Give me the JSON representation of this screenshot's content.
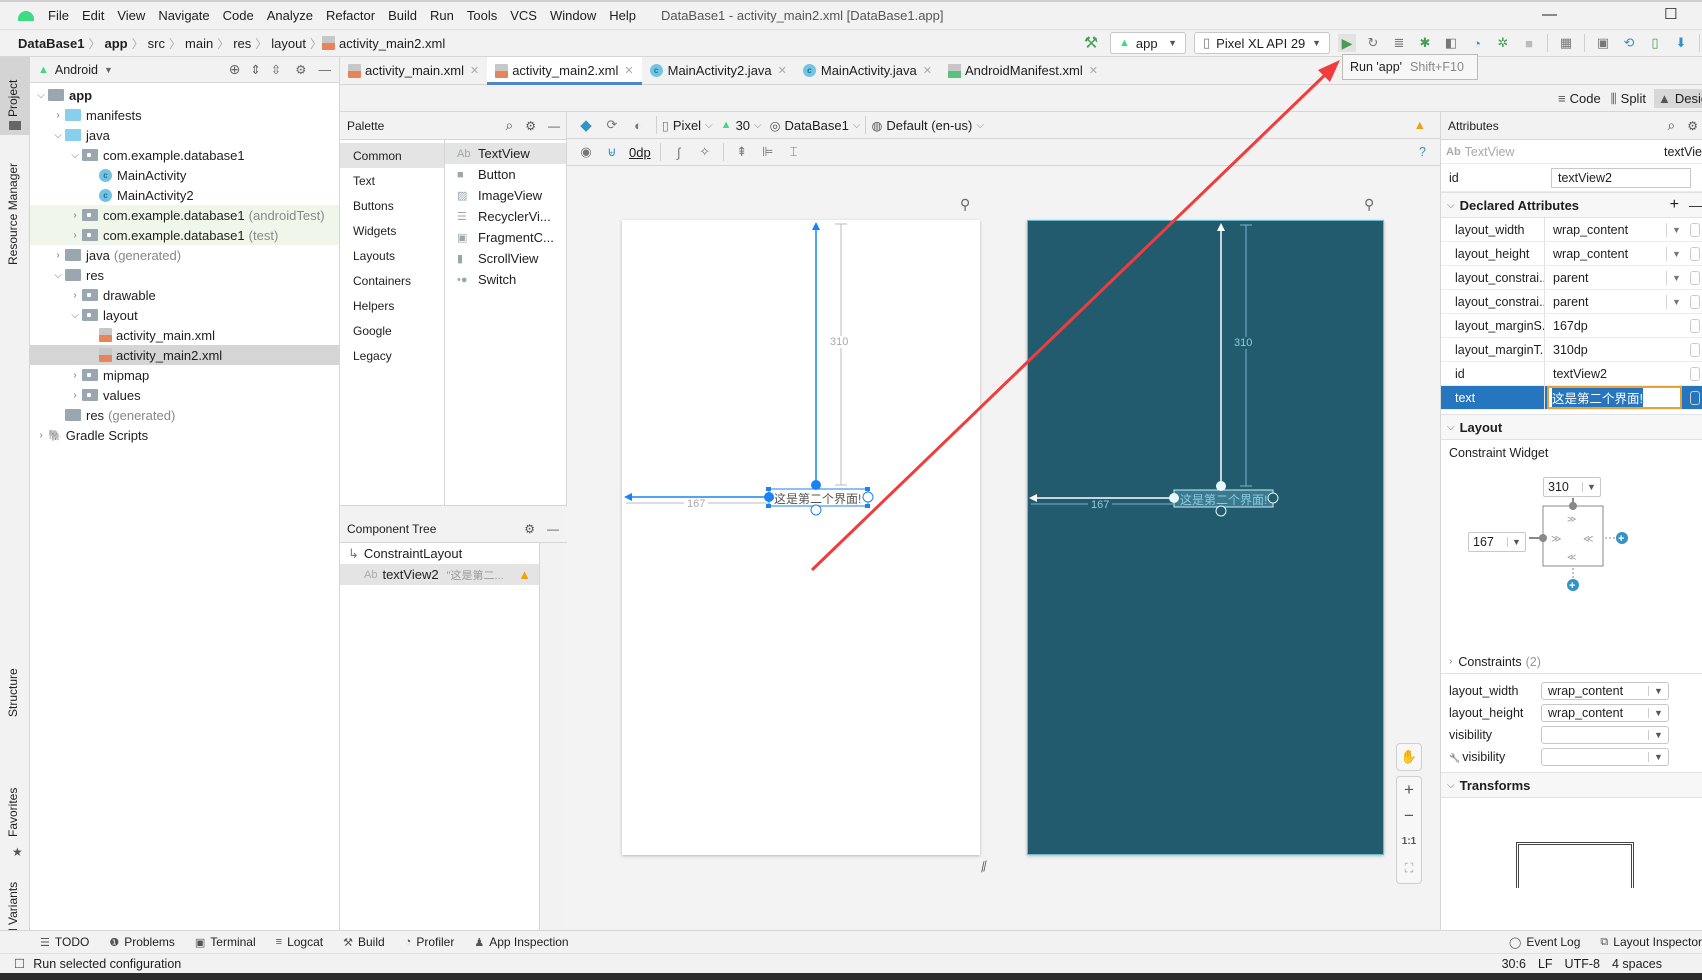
{
  "window": {
    "title": "DataBase1 - activity_main2.xml [DataBase1.app]",
    "menu": [
      "File",
      "Edit",
      "View",
      "Navigate",
      "Code",
      "Analyze",
      "Refactor",
      "Build",
      "Run",
      "Tools",
      "VCS",
      "Window",
      "Help"
    ]
  },
  "breadcrumb": [
    "DataBase1",
    "app",
    "src",
    "main",
    "res",
    "layout",
    "activity_main2.xml"
  ],
  "toolbar": {
    "run_config": "app",
    "device": "Pixel XL API 29",
    "tooltip_label": "Run 'app'",
    "tooltip_shortcut": "Shift+F10"
  },
  "left_strip": [
    "Project",
    "Resource Manager",
    "Structure",
    "Favorites",
    "Build Variants"
  ],
  "project": {
    "view_mode": "Android",
    "tree": [
      {
        "label": "app",
        "level": 0,
        "expanded": true,
        "bold": true
      },
      {
        "label": "manifests",
        "level": 1,
        "expanded": false
      },
      {
        "label": "java",
        "level": 1,
        "expanded": true
      },
      {
        "label": "com.example.database1",
        "level": 2,
        "expanded": true
      },
      {
        "label": "MainActivity",
        "level": 3,
        "type": "class"
      },
      {
        "label": "MainActivity2",
        "level": 3,
        "type": "class"
      },
      {
        "label": "com.example.database1",
        "suffix": "(androidTest)",
        "level": 2,
        "expanded": false
      },
      {
        "label": "com.example.database1",
        "suffix": "(test)",
        "level": 2,
        "expanded": false
      },
      {
        "label": "java",
        "suffix": "(generated)",
        "level": 1,
        "expanded": false
      },
      {
        "label": "res",
        "level": 1,
        "expanded": true
      },
      {
        "label": "drawable",
        "level": 2,
        "expanded": false
      },
      {
        "label": "layout",
        "level": 2,
        "expanded": true
      },
      {
        "label": "activity_main.xml",
        "level": 3,
        "type": "xml"
      },
      {
        "label": "activity_main2.xml",
        "level": 3,
        "type": "xml",
        "selected": true
      },
      {
        "label": "mipmap",
        "level": 2,
        "expanded": false
      },
      {
        "label": "values",
        "level": 2,
        "expanded": false
      },
      {
        "label": "res",
        "suffix": "(generated)",
        "level": 1
      },
      {
        "label": "Gradle Scripts",
        "level": 0,
        "expanded": false
      }
    ]
  },
  "editor_tabs": [
    {
      "label": "activity_main.xml",
      "type": "xml"
    },
    {
      "label": "activity_main2.xml",
      "type": "xml",
      "active": true
    },
    {
      "label": "MainActivity2.java",
      "type": "java"
    },
    {
      "label": "MainActivity.java",
      "type": "java"
    },
    {
      "label": "AndroidManifest.xml",
      "type": "manifest"
    }
  ],
  "view_modes": {
    "code": "Code",
    "split": "Split",
    "design": "Design"
  },
  "palette": {
    "title": "Palette",
    "categories": [
      "Common",
      "Text",
      "Buttons",
      "Widgets",
      "Layouts",
      "Containers",
      "Helpers",
      "Google",
      "Legacy"
    ],
    "items": [
      "TextView",
      "Button",
      "ImageView",
      "RecyclerVi...",
      "FragmentC...",
      "ScrollView",
      "Switch"
    ]
  },
  "component_tree": {
    "title": "Component Tree",
    "root": "ConstraintLayout",
    "child": "textView2",
    "child_preview": "\"这是第二..."
  },
  "design_toolbar": {
    "device": "Pixel",
    "api": "30",
    "theme": "DataBase1",
    "locale": "Default (en-us)",
    "margin": "0dp"
  },
  "canvas": {
    "textview_text": "这是第二个界面!",
    "margin_top": "310",
    "margin_start": "167"
  },
  "zoom_controls": {
    "one_to_one": "1:1"
  },
  "attributes": {
    "title": "Attributes",
    "widget_type": "TextView",
    "widget_id_short": "textVie",
    "id_label": "id",
    "id_value": "textView2",
    "declared_title": "Declared Attributes",
    "declared": [
      {
        "key": "layout_width",
        "value": "wrap_content",
        "dropdown": true
      },
      {
        "key": "layout_height",
        "value": "wrap_content",
        "dropdown": true
      },
      {
        "key": "layout_constrai...",
        "value": "parent",
        "dropdown": true
      },
      {
        "key": "layout_constrai...",
        "value": "parent",
        "dropdown": true
      },
      {
        "key": "layout_marginS...",
        "value": "167dp"
      },
      {
        "key": "layout_marginT...",
        "value": "310dp"
      },
      {
        "key": "id",
        "value": "textView2"
      },
      {
        "key": "text",
        "value": "这是第二个界面!",
        "selected": true
      }
    ],
    "layout_title": "Layout",
    "constraint_widget_label": "Constraint Widget",
    "cw_top": "310",
    "cw_left": "167",
    "constraints_label": "Constraints",
    "constraints_count": "(2)",
    "layout_props": [
      {
        "key": "layout_width",
        "value": "wrap_content"
      },
      {
        "key": "layout_height",
        "value": "wrap_content"
      },
      {
        "key": "visibility",
        "value": ""
      },
      {
        "key": "visibility",
        "value": "",
        "tools": true
      }
    ],
    "transforms_title": "Transforms"
  },
  "bottom_tools": [
    "TODO",
    "Problems",
    "Terminal",
    "Logcat",
    "Build",
    "Profiler",
    "App Inspection"
  ],
  "bottom_right_tools": [
    "Event Log",
    "Layout Inspector"
  ],
  "status": {
    "message": "Run selected configuration",
    "position": "30:6",
    "line_sep": "LF",
    "encoding": "UTF-8",
    "indent": "4 spaces"
  },
  "colors": {
    "accent": "#4a88c7",
    "blueprint": "#235b6e",
    "run_green": "#499c54",
    "selection": "#2675bf",
    "annotation_arrow": "#f03c3c"
  }
}
